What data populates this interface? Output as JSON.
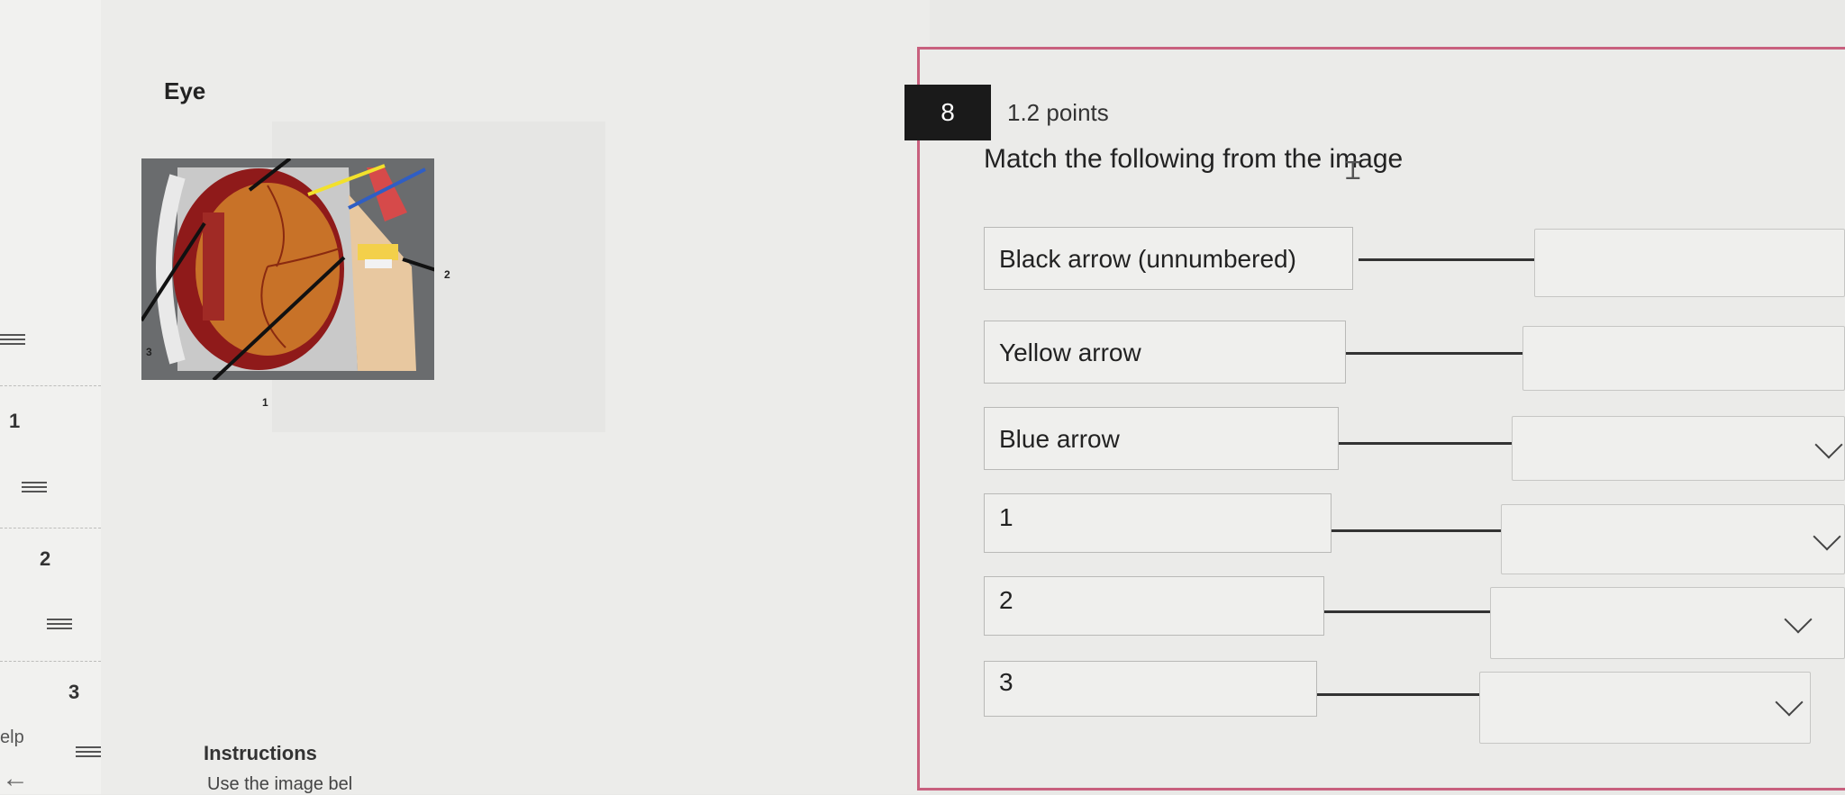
{
  "rail": {
    "numbers": [
      "1",
      "2",
      "3"
    ],
    "help_text": "elp",
    "back_icon": "arrow-left-icon"
  },
  "content": {
    "section_title": "Eye",
    "figure_labels": [
      "1",
      "2",
      "3"
    ],
    "instructions_title": "Instructions",
    "instructions_text": "Use the image bel"
  },
  "question": {
    "number": "8",
    "points": "1.2 points",
    "prompt": "Match the following from the image",
    "pairs": [
      {
        "label": "Black arrow (unnumbered)"
      },
      {
        "label": "Yellow arrow"
      },
      {
        "label": "Blue arrow"
      },
      {
        "label": "1"
      },
      {
        "label": "2"
      },
      {
        "label": "3"
      }
    ]
  },
  "colors": {
    "panel_border": "#c8607e",
    "question_badge": "#1a1a1a",
    "yellow_arrow": "#f2e12c",
    "blue_arrow": "#2f5ec4"
  }
}
